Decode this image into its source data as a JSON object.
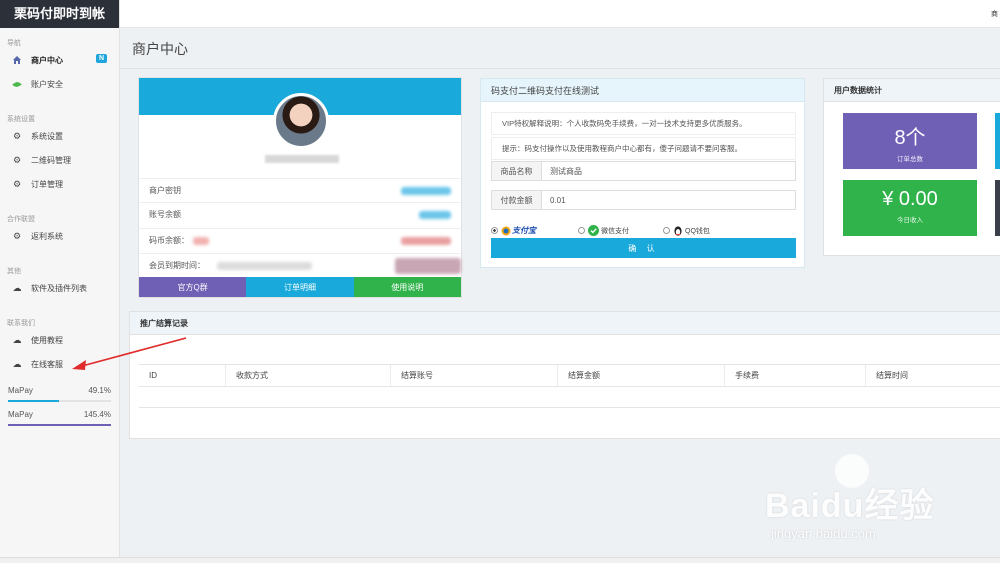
{
  "brand": "栗码付即时到帐",
  "topbar": {
    "corner_text": "商"
  },
  "sidebar": {
    "sections": [
      {
        "title": "导航"
      },
      {
        "title": "系统设置"
      },
      {
        "title": "合作联盟"
      },
      {
        "title": "其他"
      },
      {
        "title": "联系我们"
      }
    ],
    "items": [
      {
        "label": "商户中心",
        "icon": "home-icon",
        "badge": "N"
      },
      {
        "label": "账户安全",
        "icon": "leaf-icon"
      },
      {
        "label": "系统设置",
        "icon": "gear-icon"
      },
      {
        "label": "二维码管理",
        "icon": "gear-icon"
      },
      {
        "label": "订单管理",
        "icon": "gear-icon"
      },
      {
        "label": "返利系统",
        "icon": "gear-icon"
      },
      {
        "label": "软件及插件列表",
        "icon": "cloud-download-icon"
      },
      {
        "label": "使用教程",
        "icon": "cloud-download-icon"
      },
      {
        "label": "在线客服",
        "icon": "cloud-download-icon"
      }
    ],
    "stats": [
      {
        "name": "MaPay",
        "value": "49.1%",
        "fill": 0.491,
        "color": "#19a9da"
      },
      {
        "name": "MaPay",
        "value": "145.4%",
        "fill": 1.0,
        "color": "#6f5fb5"
      }
    ]
  },
  "page_title": "商户中心",
  "profile": {
    "rows": [
      {
        "label": "商户密钥"
      },
      {
        "label": "账号余额"
      },
      {
        "label": "码币余额："
      },
      {
        "label": "会员到期时间："
      }
    ],
    "buttons": [
      {
        "label": "官方Q群",
        "color": "#6f5fb5"
      },
      {
        "label": "订单明细",
        "color": "#19a9da"
      },
      {
        "label": "使用说明",
        "color": "#2fb34a"
      }
    ]
  },
  "pay": {
    "title": "码支付二维码支付在线测试",
    "note1": "VIP特权解释说明：个人收款码免手续费，一对一技术支持更多优质服务。",
    "note2": "提示：码支付操作以及使用教程商户中心都有，傻子问题请不要问客服。",
    "product_label": "商品名称",
    "product_value": "测试商品",
    "amount_label": "付款金额",
    "amount_value": "0.01",
    "methods": [
      {
        "label": "支付宝",
        "checked": true
      },
      {
        "label": "微信支付",
        "checked": false
      },
      {
        "label": "QQ钱包",
        "checked": false
      }
    ],
    "confirm_label": "确 认"
  },
  "user_stats": {
    "title": "用户数据统计",
    "tiles": [
      {
        "big": "8个",
        "small": "订单总数",
        "color": "#6f5fb5"
      },
      {
        "big": "¥ 0.00",
        "small": "今日收入",
        "color": "#2fb34a"
      }
    ]
  },
  "records": {
    "title": "推广结算记录",
    "columns": [
      "ID",
      "收款方式",
      "结算账号",
      "结算金额",
      "手续费",
      "结算时间"
    ]
  },
  "watermark": {
    "line1": "Baidu经验",
    "line2": "jingyan.baidu.com"
  }
}
